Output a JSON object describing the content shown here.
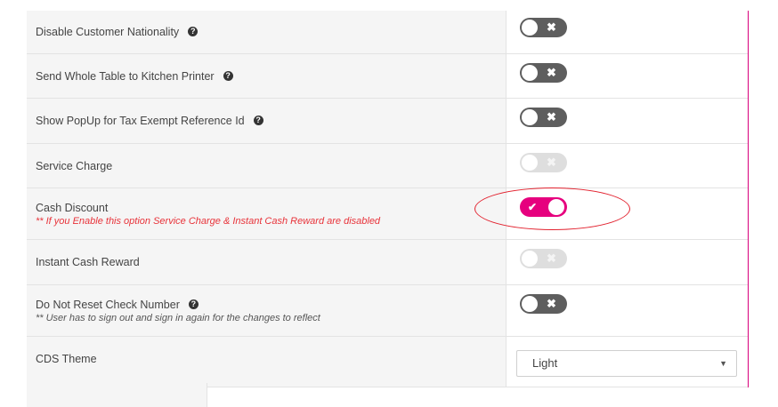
{
  "settings": [
    {
      "label": "Disable Customer Nationality",
      "help": true,
      "state": "off"
    },
    {
      "label": "Send Whole Table to Kitchen Printer",
      "help": true,
      "state": "off"
    },
    {
      "label": "Show PopUp for Tax Exempt Reference Id",
      "help": true,
      "state": "off"
    },
    {
      "label": "Service Charge",
      "help": false,
      "state": "disabled"
    },
    {
      "label": "Cash Discount",
      "help": false,
      "state": "on",
      "note": "** If you Enable this option Service Charge & Instant Cash Reward are disabled"
    },
    {
      "label": "Instant Cash Reward",
      "help": false,
      "state": "disabled"
    },
    {
      "label": "Do Not Reset Check Number",
      "help": true,
      "state": "off",
      "note": "** User has to sign out and sign in again for the changes to reflect"
    }
  ],
  "cds_theme": {
    "label": "CDS Theme",
    "selected": "Light"
  },
  "icons": {
    "help": "question-circle-icon",
    "off": "x-icon",
    "on": "check-icon"
  },
  "colors": {
    "accent": "#e6007e",
    "note_red": "#e8333a",
    "highlight": "#e2202d"
  }
}
